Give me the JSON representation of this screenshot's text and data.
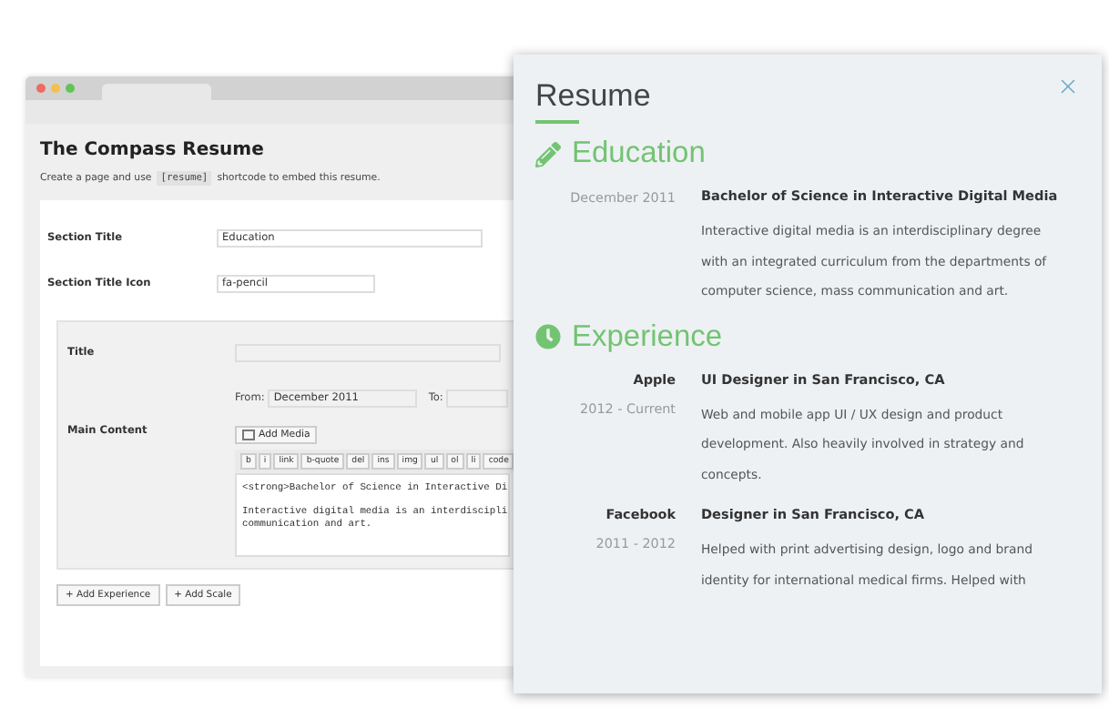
{
  "admin": {
    "title": "The Compass Resume",
    "intro_before": "Create a page and use",
    "intro_code": "[resume]",
    "intro_after": "shortcode to embed this resume.",
    "fields": [
      {
        "label": "Section Title",
        "value": "Education",
        "wide": true
      },
      {
        "label": "Section Title Icon",
        "value": "fa-pencil",
        "wide": false
      }
    ],
    "entry": {
      "title_label": "Title",
      "from_label": "From:",
      "from_value": "December 2011",
      "to_label": "To:",
      "content_label": "Main Content",
      "add_media": "Add Media",
      "toolbar": [
        "b",
        "i",
        "link",
        "b-quote",
        "del",
        "ins",
        "img",
        "ul",
        "ol",
        "li",
        "code"
      ],
      "content_paragraphs": [
        [
          "<strong>Bachelor of Science in Interactive Di"
        ],
        [
          "Interactive digital media is an interdiscipli",
          "communication and art."
        ]
      ]
    },
    "buttons": [
      "+ Add Experience",
      "+ Add Scale"
    ]
  },
  "panel": {
    "title": "Resume",
    "sections": [
      {
        "kind": "education",
        "heading": "Education",
        "entries": [
          {
            "date": "December 2011",
            "title": "Bachelor of Science in Interactive Digital Media",
            "description": "Interactive digital media is an interdisciplinary degree with an integrated curriculum from the departments of computer science, mass communication and art."
          }
        ]
      },
      {
        "kind": "experience",
        "heading": "Experience",
        "entries": [
          {
            "org": "Apple",
            "date": "2012 - Current",
            "title": "UI Designer in San Francisco, CA",
            "description": "Web and mobile app UI / UX design and product development. Also heavily involved in strategy and concepts."
          },
          {
            "org": "Facebook",
            "date": "2011 - 2012",
            "title": "Designer in San Francisco, CA",
            "description": "Helped with print advertising design, logo and brand identity for international medical firms. Helped with"
          }
        ]
      }
    ]
  }
}
